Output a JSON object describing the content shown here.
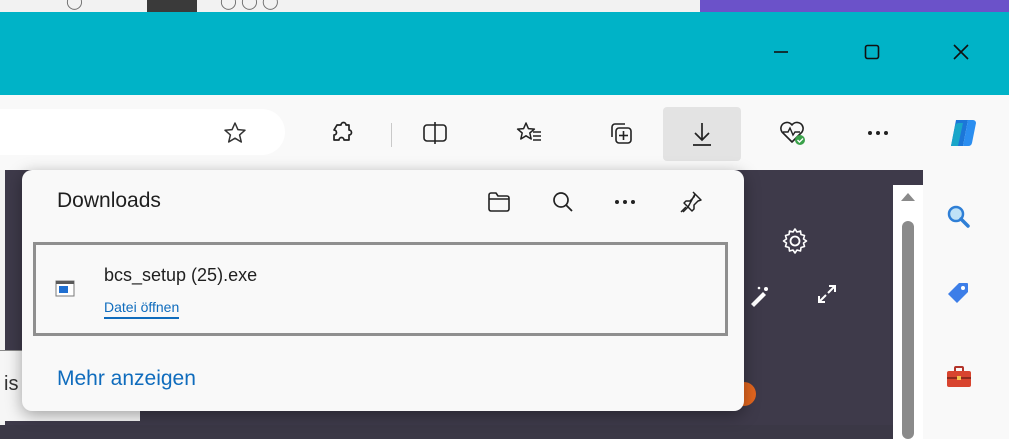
{
  "colors": {
    "titlebar": "#00b3c7",
    "link": "#0f6cbd",
    "page_background": "#3e3a4a"
  },
  "window_controls": {
    "minimize_icon": "minimize-icon",
    "maximize_icon": "maximize-icon",
    "close_icon": "close-icon"
  },
  "toolbar": {
    "icons": [
      "star-icon",
      "extensions-icon",
      "split-screen-icon",
      "favorites-icon",
      "collections-icon",
      "download-icon",
      "browser-essentials-icon",
      "more-icon",
      "copilot-icon"
    ]
  },
  "downloads": {
    "title": "Downloads",
    "header_icons": [
      "folder-icon",
      "search-icon",
      "more-icon",
      "pin-icon"
    ],
    "items": [
      {
        "file_name": "bcs_setup (25).exe",
        "action": "Datei öffnen"
      }
    ],
    "show_more": "Mehr anzeigen"
  },
  "sidebar": {
    "icons": [
      "search-icon",
      "shopping-tag-icon",
      "tools-icon"
    ]
  },
  "page": {
    "partial_text": "is"
  }
}
